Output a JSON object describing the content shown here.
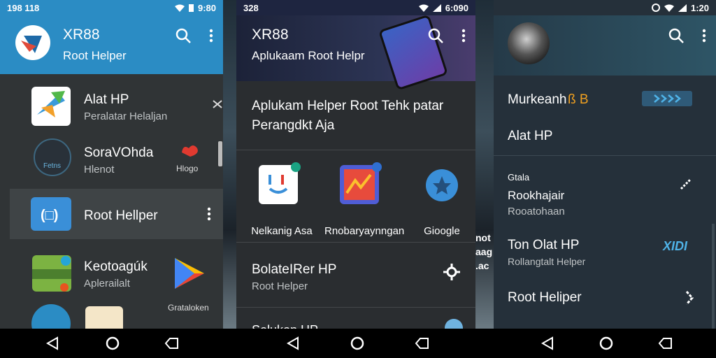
{
  "phone1": {
    "status": {
      "time": "198 118",
      "right": "9:80"
    },
    "app": {
      "title": "XR88",
      "subtitle": "Root Helper"
    },
    "items": [
      {
        "title": "Alat HP",
        "subtitle": "Peralatar Helaljan"
      },
      {
        "title": "SoraVOhda",
        "subtitle": "Hlenot",
        "icon_label": "Fetns",
        "side_label": "Hlogo"
      },
      {
        "title": "Root Hellper"
      },
      {
        "title": "Keotoagúk",
        "subtitle": "Aplerailalt",
        "side_label": "Grataloken"
      }
    ]
  },
  "phone2": {
    "status": {
      "time": "328",
      "right": "6:090"
    },
    "app": {
      "title": "XR88",
      "subtitle": "Aplukaam Root Helpr"
    },
    "headline": "Aplukam Helper Root Tehk patar Perangdkt Aja",
    "apps": [
      {
        "label": "Nelkanig Asa"
      },
      {
        "label": "Rnobaryaynngan"
      },
      {
        "label": "Gioogle"
      }
    ],
    "card": {
      "title": "BolateIRer HP",
      "subtitle": "Root Helper"
    },
    "partial": "Solukon HP"
  },
  "phone3": {
    "status": {
      "right": "1:20"
    },
    "items": [
      {
        "title": "Murkeanh",
        "tag": "ß B"
      },
      {
        "title": "Alat HP"
      },
      {
        "title": "Gtala",
        "subtitle": "Rookhajair",
        "extra": "Rooatohaan"
      },
      {
        "title": "Ton Olat HP",
        "subtitle": "Rollangtalt Helper",
        "badge": "XIDI"
      },
      {
        "title": "Root Heliper"
      }
    ]
  },
  "gap_text": [
    "not",
    "aag",
    ".ac"
  ],
  "colors": {
    "accent": "#2b8cc4",
    "dark_bg": "#303436"
  }
}
